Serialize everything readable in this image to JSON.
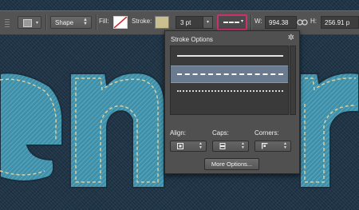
{
  "toolbar": {
    "mode": "Shape",
    "fill_label": "Fill:",
    "stroke_label": "Stroke:",
    "stroke_width": "3 pt",
    "w_label": "W:",
    "w_value": "994.38",
    "h_label": "H:",
    "h_value": "256.91 p",
    "icons": [
      "tool-preset-icon",
      "fill-swatch",
      "stroke-swatch",
      "stroke-type-picker",
      "link-icon"
    ],
    "stroke_color": "#cbbf90",
    "highlight_color": "#c8336d"
  },
  "popup": {
    "title": "Stroke Options",
    "stroke_types": [
      "solid",
      "dashed",
      "dotted"
    ],
    "selected_type": "dashed",
    "align_label": "Align:",
    "caps_label": "Caps:",
    "corners_label": "Corners:",
    "more_button": "More Options..."
  },
  "canvas": {
    "letters": [
      "e",
      "n",
      "n"
    ],
    "letter_color": "#3f8fa8",
    "stitch_color": "#d9cfa0"
  }
}
